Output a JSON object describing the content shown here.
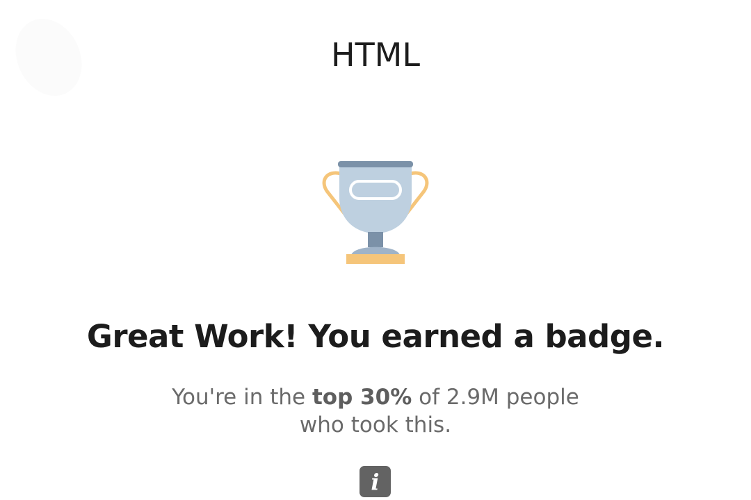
{
  "header": {
    "title": "HTML"
  },
  "result": {
    "headline": "Great Work! You earned a badge.",
    "sub_prefix": "You're in the ",
    "sub_highlight": "top 30%",
    "sub_suffix": " of 2.9M people",
    "sub_line2": "who took this."
  },
  "info_button": {
    "icon": "info-icon",
    "glyph": "i"
  },
  "colors": {
    "cup": "#bed0e0",
    "cup_dark": "#7b91a8",
    "gold": "#f5c57a",
    "info_bg": "#636363"
  }
}
